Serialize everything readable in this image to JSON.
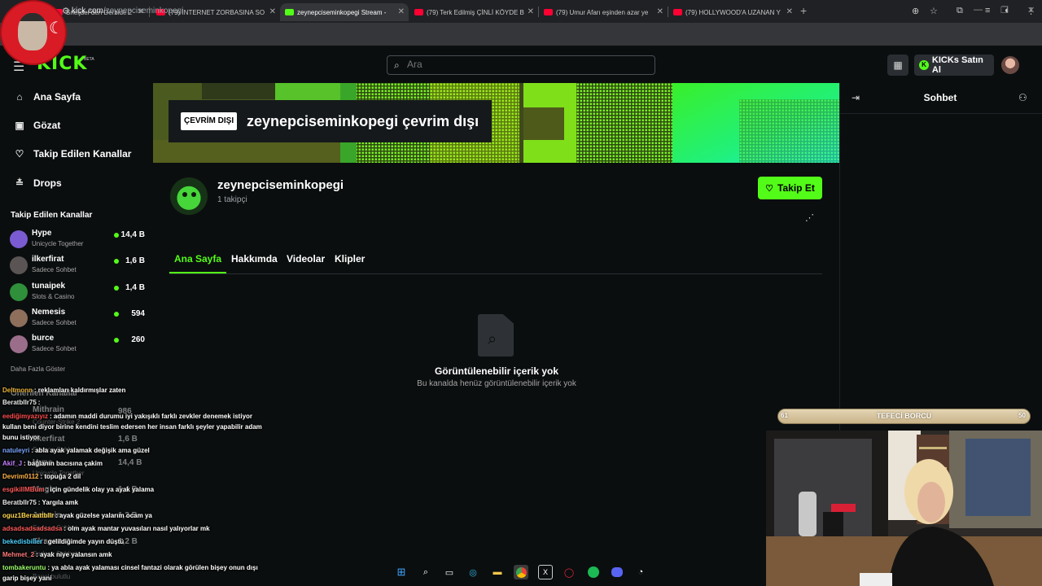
{
  "browser": {
    "tabs": [
      {
        "title": "Sneijder'den Derbide 2",
        "icon": "youtube-icon"
      },
      {
        "title": "(79) İNTERNET ZORBASINA SO",
        "icon": "youtube-icon"
      },
      {
        "title": "zeynepciseminkopegi Stream -",
        "icon": "kick-icon",
        "active": true
      },
      {
        "title": "(79) Terk Edilmiş ÇİNLİ KÖYDE B",
        "icon": "youtube-icon"
      },
      {
        "title": "(79) Umur Afarı eşinden azar ye",
        "icon": "youtube-icon"
      },
      {
        "title": "(79) HOLLYWOOD'A UZANAN Y",
        "icon": "youtube-icon"
      }
    ],
    "url_host": "kick.com",
    "url_path": "/zeynepciseminkopegi"
  },
  "header": {
    "logo": "KICK",
    "logo_badge": "BETA",
    "search_placeholder": "Ara",
    "buy_kicks_label": "KICKs Satın Al"
  },
  "sidebar": {
    "nav": [
      {
        "label": "Ana Sayfa",
        "icon": "home-icon"
      },
      {
        "label": "Gözat",
        "icon": "browse-icon"
      },
      {
        "label": "Takip Edilen Kanallar",
        "icon": "heart-icon"
      },
      {
        "label": "Drops",
        "icon": "drops-icon"
      }
    ],
    "followed_title": "Takip Edilen Kanallar",
    "channels": [
      {
        "name": "Hype",
        "category": "Unicycle Together",
        "viewers": "14,4 B",
        "color": "#7a5bd1"
      },
      {
        "name": "ilkerfirat",
        "category": "Sadece Sohbet",
        "viewers": "1,6 B",
        "color": "#5b5454"
      },
      {
        "name": "tunaipek",
        "category": "Slots & Casino",
        "viewers": "1,4 B",
        "color": "#2f8f3a"
      },
      {
        "name": "Nemesis",
        "category": "Sadece Sohbet",
        "viewers": "594",
        "color": "#8d6f5c"
      },
      {
        "name": "burce",
        "category": "Sadece Sohbet",
        "viewers": "260",
        "color": "#9a6e8a"
      }
    ],
    "show_more": "Daha Fazla Göster"
  },
  "banner": {
    "offline_badge": "ÇEVRİM DIŞI",
    "offline_text": "zeynepciseminkopegi çevrim dışı"
  },
  "channel": {
    "name": "zeynepciseminkopegi",
    "followers": "1 takipçi",
    "follow_label": "Takip Et",
    "tabs": [
      "Ana Sayfa",
      "Hakkımda",
      "Videolar",
      "Klipler"
    ],
    "active_tab": 0,
    "empty_title": "Görüntülenebilir içerik yok",
    "empty_subtitle": "Bu kanalda henüz görüntülenebilir içerik yok"
  },
  "chat": {
    "title": "Sohbet"
  },
  "stream_overlay": {
    "debt_label": "TEFECİ BORCU",
    "debt_left": "61",
    "debt_right": "50",
    "debt_progress": 0.5,
    "chat_messages": [
      {
        "user": "Deltmonn",
        "text": ": reklamları kaldırmışlar zaten",
        "color": "#e8b23a"
      },
      {
        "user": "Beratbllr75",
        "text": ":",
        "color": "#e8e8e8"
      },
      {
        "user": "eediğimyazıyız",
        "text": ": adamın maddi durumu iyi yakışıklı farklı zevkler denemek istiyor",
        "color": "#ff4d4d"
      },
      {
        "user": "",
        "text": "kullan beni diyor birine kendini teslim edersen her insan farklı şeyler yapabilir adam",
        "color": "#fff"
      },
      {
        "user": "",
        "text": "bunu istiyor",
        "color": "#fff"
      },
      {
        "user": "natuleyri",
        "text": ": abla ayak yalamak değişik ama güzel",
        "color": "#7aa6ff"
      },
      {
        "user": "Akif_J",
        "text": ": bağlanın bacısına çakim",
        "color": "#c77dff"
      },
      {
        "user": "Devrim0112",
        "text": ": topuğa 2 dil",
        "color": "#ffb347"
      },
      {
        "user": "esgikillMBüm",
        "text": ": için gündelik olay ya ayak yalama",
        "color": "#ff5a5a"
      },
      {
        "user": "Beratbllr75",
        "text": ": Yargıla amk",
        "color": "#e8e8e8"
      },
      {
        "user": "oguz1Beraattbllr",
        "text": ": ayak güzelse yalarım ocam ya",
        "color": "#ffd84d"
      },
      {
        "user": "adsadsadsadsadsa",
        "text": ": olm ayak mantar yuvasıları nasıl yalıyorlar mk",
        "color": "#ff5a5a"
      },
      {
        "user": "bekedisbiller",
        "text": ": gelildiğimde yayın düştü",
        "color": "#4dd2ff"
      },
      {
        "user": "Mehmet_2",
        "text": ": ayak niye yalansın amk",
        "color": "#ff7a7a"
      },
      {
        "user": "tombakeruntu",
        "text": ": ya abla ayak yalaması cinsel fantazi olarak görülen bişey onun dışı",
        "color": "#9cff6b"
      },
      {
        "user": "",
        "text": "garip bişey yani",
        "color": "#fff"
      }
    ],
    "under_sidebar": [
      {
        "text": "Önerilen Kanallar"
      },
      {
        "text": "Mithrain"
      },
      {
        "text": "986"
      },
      {
        "text": "Counter-Strike 2"
      },
      {
        "text": "ilkerfirat"
      },
      {
        "text": "1,6 B"
      },
      {
        "text": "Sadece Sohbet"
      },
      {
        "text": "Hype"
      },
      {
        "text": "14,4 B"
      },
      {
        "text": "Unicycle Together"
      },
      {
        "text": "Mugin"
      },
      {
        "text": "1,4 B"
      },
      {
        "text": "Jahrein"
      },
      {
        "text": "1,3 B"
      },
      {
        "text": "Sadece Sohbet"
      },
      {
        "text": "Elraenn"
      },
      {
        "text": "1,2 B"
      },
      {
        "text": "Sadece Sohbet"
      },
      {
        "text": "Bagel bulutlu"
      }
    ]
  }
}
